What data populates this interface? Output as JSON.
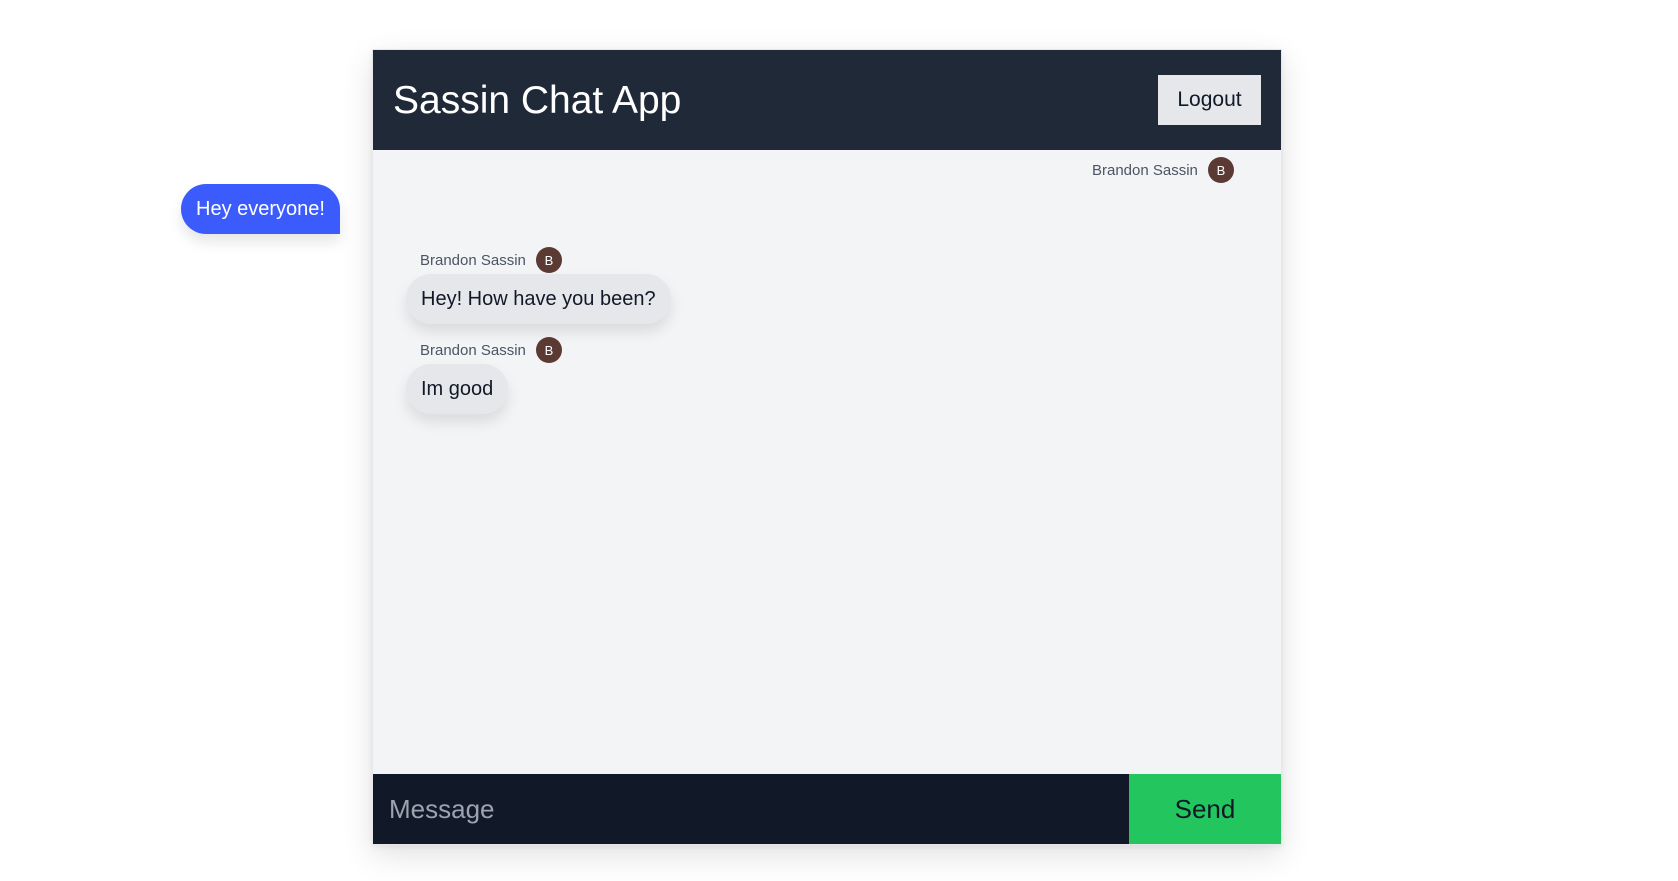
{
  "header": {
    "title": "Sassin Chat App",
    "logout_label": "Logout"
  },
  "messages": [
    {
      "sender": "Brandon Sassin",
      "avatar_initial": "B",
      "text": "Hey everyone!",
      "own": true
    },
    {
      "sender": "Brandon Sassin",
      "avatar_initial": "B",
      "text": "Hey! How have you been?",
      "own": false
    },
    {
      "sender": "Brandon Sassin",
      "avatar_initial": "B",
      "text": "Im good",
      "own": false
    }
  ],
  "composer": {
    "placeholder": "Message",
    "value": "",
    "send_label": "Send"
  },
  "colors": {
    "header_bg": "#1f2937",
    "own_bubble": "#3b5bfd",
    "other_bubble": "#e5e7eb",
    "avatar_bg": "#5b3a33",
    "send_button": "#22c55e",
    "composer_bg": "#111827"
  }
}
